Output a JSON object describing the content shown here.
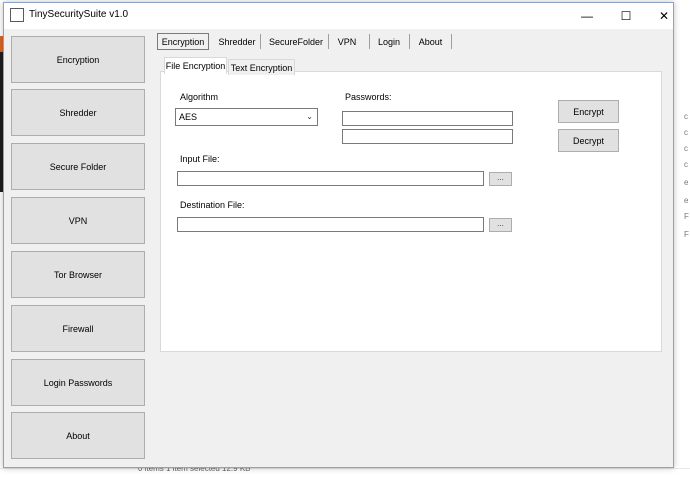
{
  "window": {
    "title": "TinySecuritySuite v1.0",
    "minimize_glyph": "—",
    "maximize_glyph": "☐",
    "close_glyph": "✕"
  },
  "sidebar": {
    "items": [
      {
        "label": "Encryption"
      },
      {
        "label": "Shredder"
      },
      {
        "label": "Secure Folder"
      },
      {
        "label": "VPN"
      },
      {
        "label": "Tor Browser"
      },
      {
        "label": "Firewall"
      },
      {
        "label": "Login Passwords"
      },
      {
        "label": "About"
      }
    ]
  },
  "tabs": {
    "items": [
      {
        "label": "Encryption",
        "active": true
      },
      {
        "label": "Shredder"
      },
      {
        "label": "SecureFolder"
      },
      {
        "label": "VPN"
      },
      {
        "label": "Login"
      },
      {
        "label": "About"
      }
    ]
  },
  "subtabs": {
    "items": [
      {
        "label": "File Encryption",
        "active": true
      },
      {
        "label": "Text Encryption"
      }
    ]
  },
  "form": {
    "algorithm_label": "Algorithm",
    "algorithm_value": "AES",
    "passwords_label": "Passwords:",
    "password1_value": "",
    "password2_value": "",
    "input_file_label": "Input File:",
    "input_file_value": "",
    "destination_file_label": "Destination File:",
    "destination_file_value": "",
    "browse_label": "...",
    "encrypt_label": "Encrypt",
    "decrypt_label": "Decrypt"
  },
  "background": {
    "status_text": "0 items     1 item selected  12.9 KB"
  },
  "colors": {
    "window_border": "#8ca2c6",
    "window_bg": "#f0f0f0",
    "button_bg": "#e1e1e1",
    "button_border": "#adadad"
  }
}
